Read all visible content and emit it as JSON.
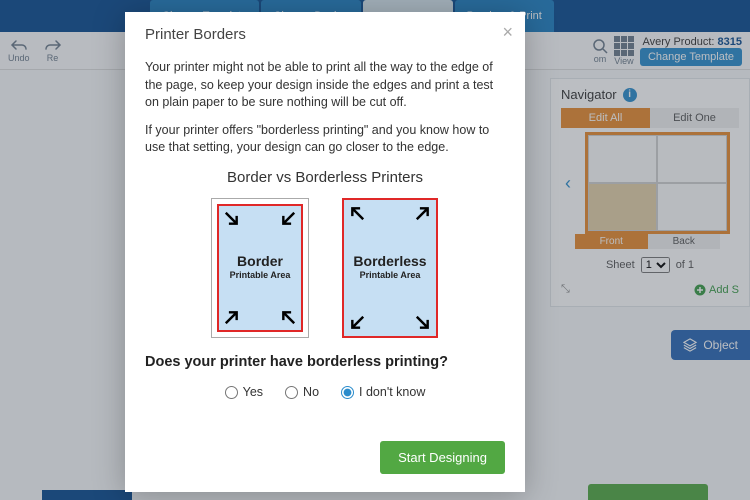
{
  "topTabs": [
    "Choose Template",
    "Choose Design",
    "",
    "Preview & Print"
  ],
  "toolbar": {
    "undo": "Undo",
    "redo": "Re",
    "zoom": "om",
    "view": "View"
  },
  "product": {
    "label": "Avery Product:",
    "number": "8315",
    "change": "Change Template"
  },
  "navigator": {
    "title": "Navigator",
    "editAll": "Edit All",
    "editOne": "Edit One",
    "front": "Front",
    "back": "Back",
    "sheetLabel": "Sheet",
    "sheetValue": "1",
    "sheetOf": "of 1",
    "add": "Add S"
  },
  "objectBtn": "Object",
  "modal": {
    "title": "Printer Borders",
    "p1": "Your printer might not be able to print all the way to the edge of the page, so keep your design inside the edges and print a test on plain paper to be sure nothing will be cut off.",
    "p2": "If your printer offers \"borderless printing\" and you know how to use that setting, your design can go closer to the edge.",
    "compareTitle": "Border vs Borderless Printers",
    "borderLabel": "Border",
    "borderSub": "Printable Area",
    "borderlessLabel": "Borderless",
    "borderlessSub": "Printable Area",
    "question": "Does your printer have borderless printing?",
    "optYes": "Yes",
    "optNo": "No",
    "optIdk": "I don't know",
    "startBtn": "Start Designing"
  }
}
